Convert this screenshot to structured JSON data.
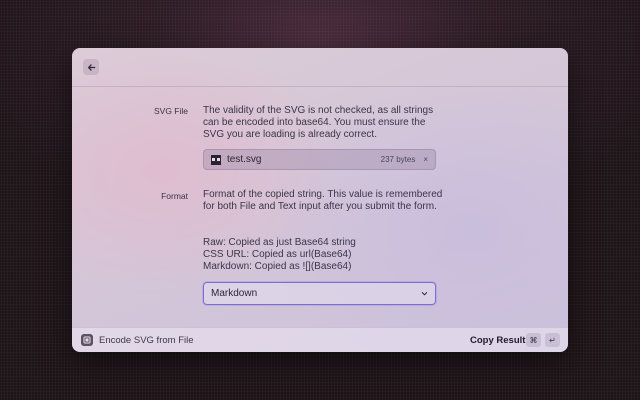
{
  "form": {
    "svg_file": {
      "label": "SVG File",
      "description": "The validity of the SVG is not checked, as all strings can be encoded into base64. You must ensure the SVG you are loading is already correct.",
      "file": {
        "name": "test.svg",
        "size": "237 bytes",
        "remove_glyph": "×"
      }
    },
    "format": {
      "label": "Format",
      "description": "Format of the copied string. This value is remembered for both File and Text input after you submit the form.",
      "options_lines": [
        "Raw: Copied as just Base64 string",
        "CSS URL: Copied as url(Base64)",
        "Markdown: Copied as ![](Base64)"
      ],
      "selected": "Markdown"
    }
  },
  "footer": {
    "title": "Encode SVG from File",
    "action_label": "Copy Result",
    "shortcut_mod": "⌘",
    "shortcut_key": "↵"
  },
  "icons": {
    "back": "back-arrow-icon",
    "file": "svg-file-icon",
    "chevron": "chevron-down-icon",
    "extension": "extension-icon"
  },
  "colors": {
    "focus_ring": "#7b6fd6"
  }
}
